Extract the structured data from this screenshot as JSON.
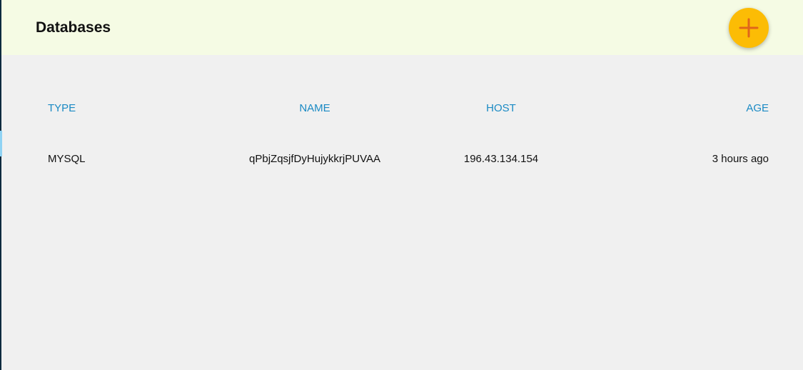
{
  "header": {
    "title": "Databases",
    "add_button_icon": "plus-icon",
    "accent_color": "#fcbc05"
  },
  "table": {
    "columns": [
      "TYPE",
      "NAME",
      "HOST",
      "AGE"
    ],
    "rows": [
      {
        "type": "MYSQL",
        "name": "qPbjZqsjfDyHujykkrjPUVAA",
        "host": "196.43.134.154",
        "age": "3 hours ago"
      }
    ]
  },
  "colors": {
    "header_bg": "#f5fbe4",
    "page_bg": "#f0f0f0",
    "column_header_text": "#1a8ac4"
  }
}
